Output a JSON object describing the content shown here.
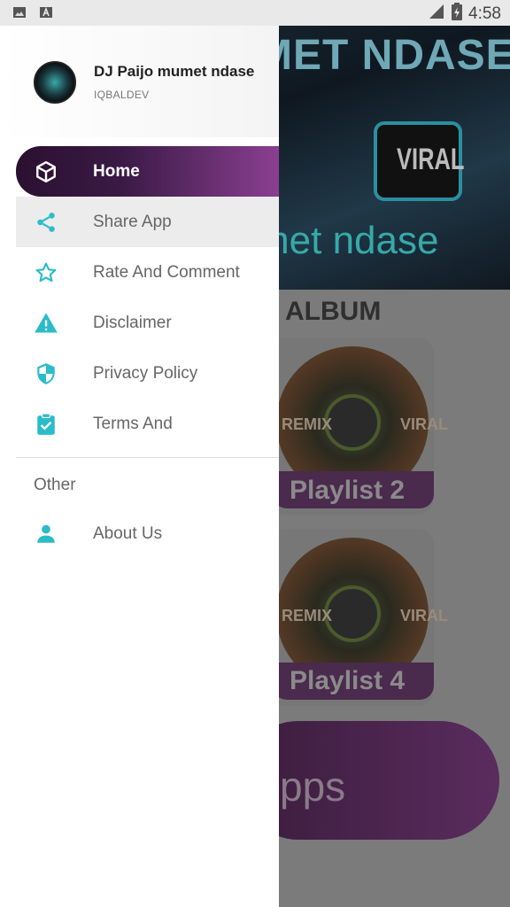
{
  "status_bar": {
    "time": "4:58",
    "icons": [
      "image-icon",
      "text-icon",
      "signal-icon",
      "battery-icon"
    ]
  },
  "drawer": {
    "app_name": "DJ Paijo mumet ndase",
    "developer": "IQBALDEV",
    "menu_items": [
      {
        "label": "Home",
        "icon": "cube-icon"
      },
      {
        "label": "Share App",
        "icon": "share-icon"
      },
      {
        "label": "Rate And Comment",
        "icon": "star-icon"
      },
      {
        "label": "Disclaimer",
        "icon": "warning-icon"
      },
      {
        "label": "Privacy Policy",
        "icon": "shield-icon"
      },
      {
        "label": "Terms And",
        "icon": "clipboard-check-icon"
      }
    ],
    "section_other": "Other",
    "other_items": [
      {
        "label": "About Us",
        "icon": "person-icon"
      }
    ],
    "colors": {
      "accent": "#2bbcc9",
      "active_start": "#2b1030",
      "active_end": "#8a3f90"
    }
  },
  "background": {
    "banner_title": "MET NDASE",
    "banner_subtitle": "met ndase",
    "banner_badge": "VIRAL",
    "section_title": "ALBUM",
    "playlists": [
      {
        "label": "Playlist 2",
        "badge_left": "REMIX",
        "badge_right": "VIRAL"
      },
      {
        "label": "Playlist 4",
        "badge_left": "REMIX",
        "badge_right": "VIRAL"
      }
    ],
    "bottom_button": "pps"
  }
}
